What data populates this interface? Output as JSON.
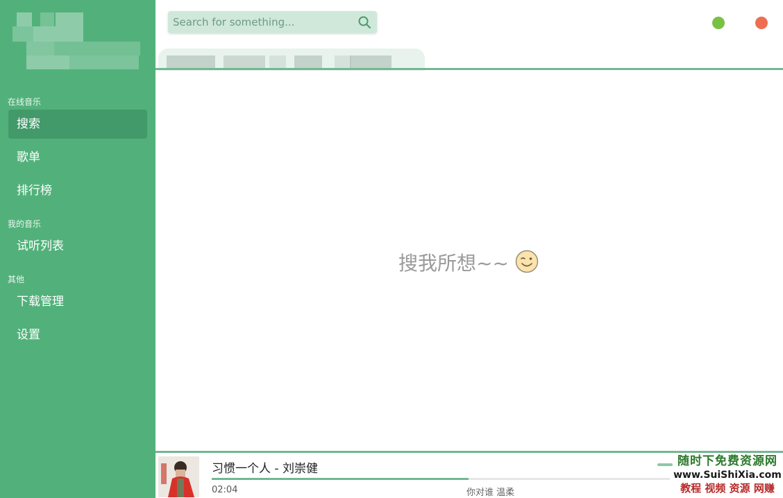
{
  "sidebar": {
    "sections": [
      {
        "label": "在线音乐"
      },
      {
        "label": "我的音乐"
      },
      {
        "label": "其他"
      }
    ],
    "items": [
      {
        "label": "搜索",
        "active": true
      },
      {
        "label": "歌单"
      },
      {
        "label": "排行榜"
      },
      {
        "label": "试听列表"
      },
      {
        "label": "下载管理"
      },
      {
        "label": "设置"
      }
    ]
  },
  "search": {
    "placeholder": "Search for something...",
    "value": ""
  },
  "window": {
    "minimize_color": "#7ac143",
    "close_color": "#ee6e52"
  },
  "main": {
    "empty_message": "搜我所想~~",
    "empty_icon": "wink-smiley-icon"
  },
  "player": {
    "title": "习惯一个人 - 刘崇健",
    "current_time": "02:04",
    "lyric": "你对谁 温柔",
    "progress": 0.56
  },
  "watermark": {
    "line1": "随时下免费资源网",
    "line2": "www.SuiShiXia.com",
    "line3": "教程 视频 资源 网赚"
  },
  "colors": {
    "accent": "#52b17b",
    "accent_dark": "#42996a",
    "line": "#71b891"
  }
}
